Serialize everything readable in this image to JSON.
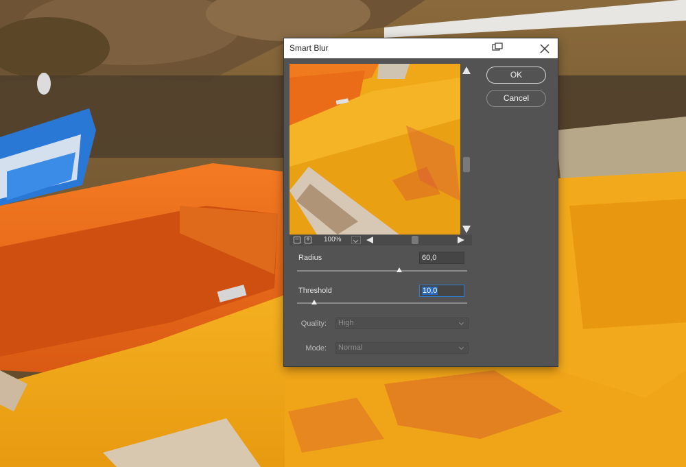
{
  "dialog": {
    "title": "Smart Blur",
    "ok_label": "OK",
    "cancel_label": "Cancel",
    "zoom_level": "100%",
    "radius": {
      "label": "Radius",
      "value": "60,0",
      "slider_fraction": 0.6
    },
    "threshold": {
      "label": "Threshold",
      "value": "10,0",
      "slider_fraction": 0.1
    },
    "quality": {
      "label": "Quality:",
      "selected": "High"
    },
    "mode": {
      "label": "Mode:",
      "selected": "Normal"
    }
  },
  "icons": [
    "restore-window-icon",
    "close-icon",
    "zoom-out-icon",
    "zoom-in-icon",
    "chevron-down-icon",
    "scroll-up-arrow",
    "scroll-down-arrow",
    "scroll-left-arrow",
    "scroll-right-arrow"
  ],
  "colors": {
    "dialog_bg": "#535353",
    "titlebar_bg": "#ffffff",
    "highlight": "#2a68b8",
    "boat_orange": "#f07a1e",
    "boat_yellow": "#f0a81a",
    "boat_blue": "#2a78d6"
  }
}
